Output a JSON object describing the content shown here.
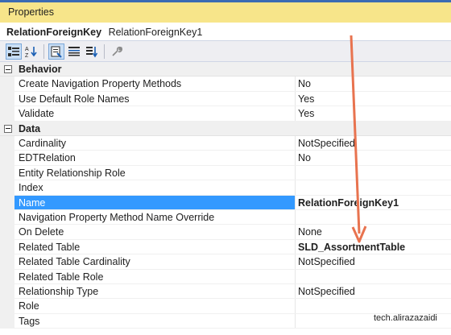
{
  "window": {
    "title": "Properties"
  },
  "object": {
    "name": "RelationForeignKey",
    "type": "RelationForeignKey1"
  },
  "toolbar": {
    "buttons": [
      {
        "icon": "categorized-icon",
        "active": true
      },
      {
        "icon": "alphabetical-icon",
        "active": false
      },
      {
        "icon": "properties-icon",
        "active": true
      },
      {
        "icon": "events-icon",
        "active": false
      },
      {
        "icon": "property-pages-icon",
        "active": false
      },
      {
        "icon": "wrench-icon",
        "active": false
      }
    ]
  },
  "categories": {
    "behavior": "Behavior",
    "data": "Data"
  },
  "properties": {
    "create_nav_methods": {
      "label": "Create Navigation Property Methods",
      "value": "No"
    },
    "use_default_role_names": {
      "label": "Use Default Role Names",
      "value": "Yes"
    },
    "validate": {
      "label": "Validate",
      "value": "Yes"
    },
    "cardinality": {
      "label": "Cardinality",
      "value": "NotSpecified"
    },
    "edt_relation": {
      "label": "EDTRelation",
      "value": "No"
    },
    "entity_relationship_role": {
      "label": "Entity Relationship Role",
      "value": ""
    },
    "index": {
      "label": "Index",
      "value": ""
    },
    "name": {
      "label": "Name",
      "value": "RelationForeignKey1"
    },
    "nav_method_name_override": {
      "label": "Navigation Property Method Name Override",
      "value": ""
    },
    "on_delete": {
      "label": "On Delete",
      "value": "None"
    },
    "related_table": {
      "label": "Related Table",
      "value": "SLD_AssortmentTable"
    },
    "related_table_cardinality": {
      "label": "Related Table Cardinality",
      "value": "NotSpecified"
    },
    "related_table_role": {
      "label": "Related Table Role",
      "value": ""
    },
    "relationship_type": {
      "label": "Relationship Type",
      "value": "NotSpecified"
    },
    "role": {
      "label": "Role",
      "value": ""
    },
    "tags": {
      "label": "Tags",
      "value": ""
    }
  },
  "watermark": "tech.alirazazaidi",
  "colors": {
    "title_bar": "#f7e58a",
    "selection": "#3399ff",
    "arrow": "#e8734f"
  }
}
